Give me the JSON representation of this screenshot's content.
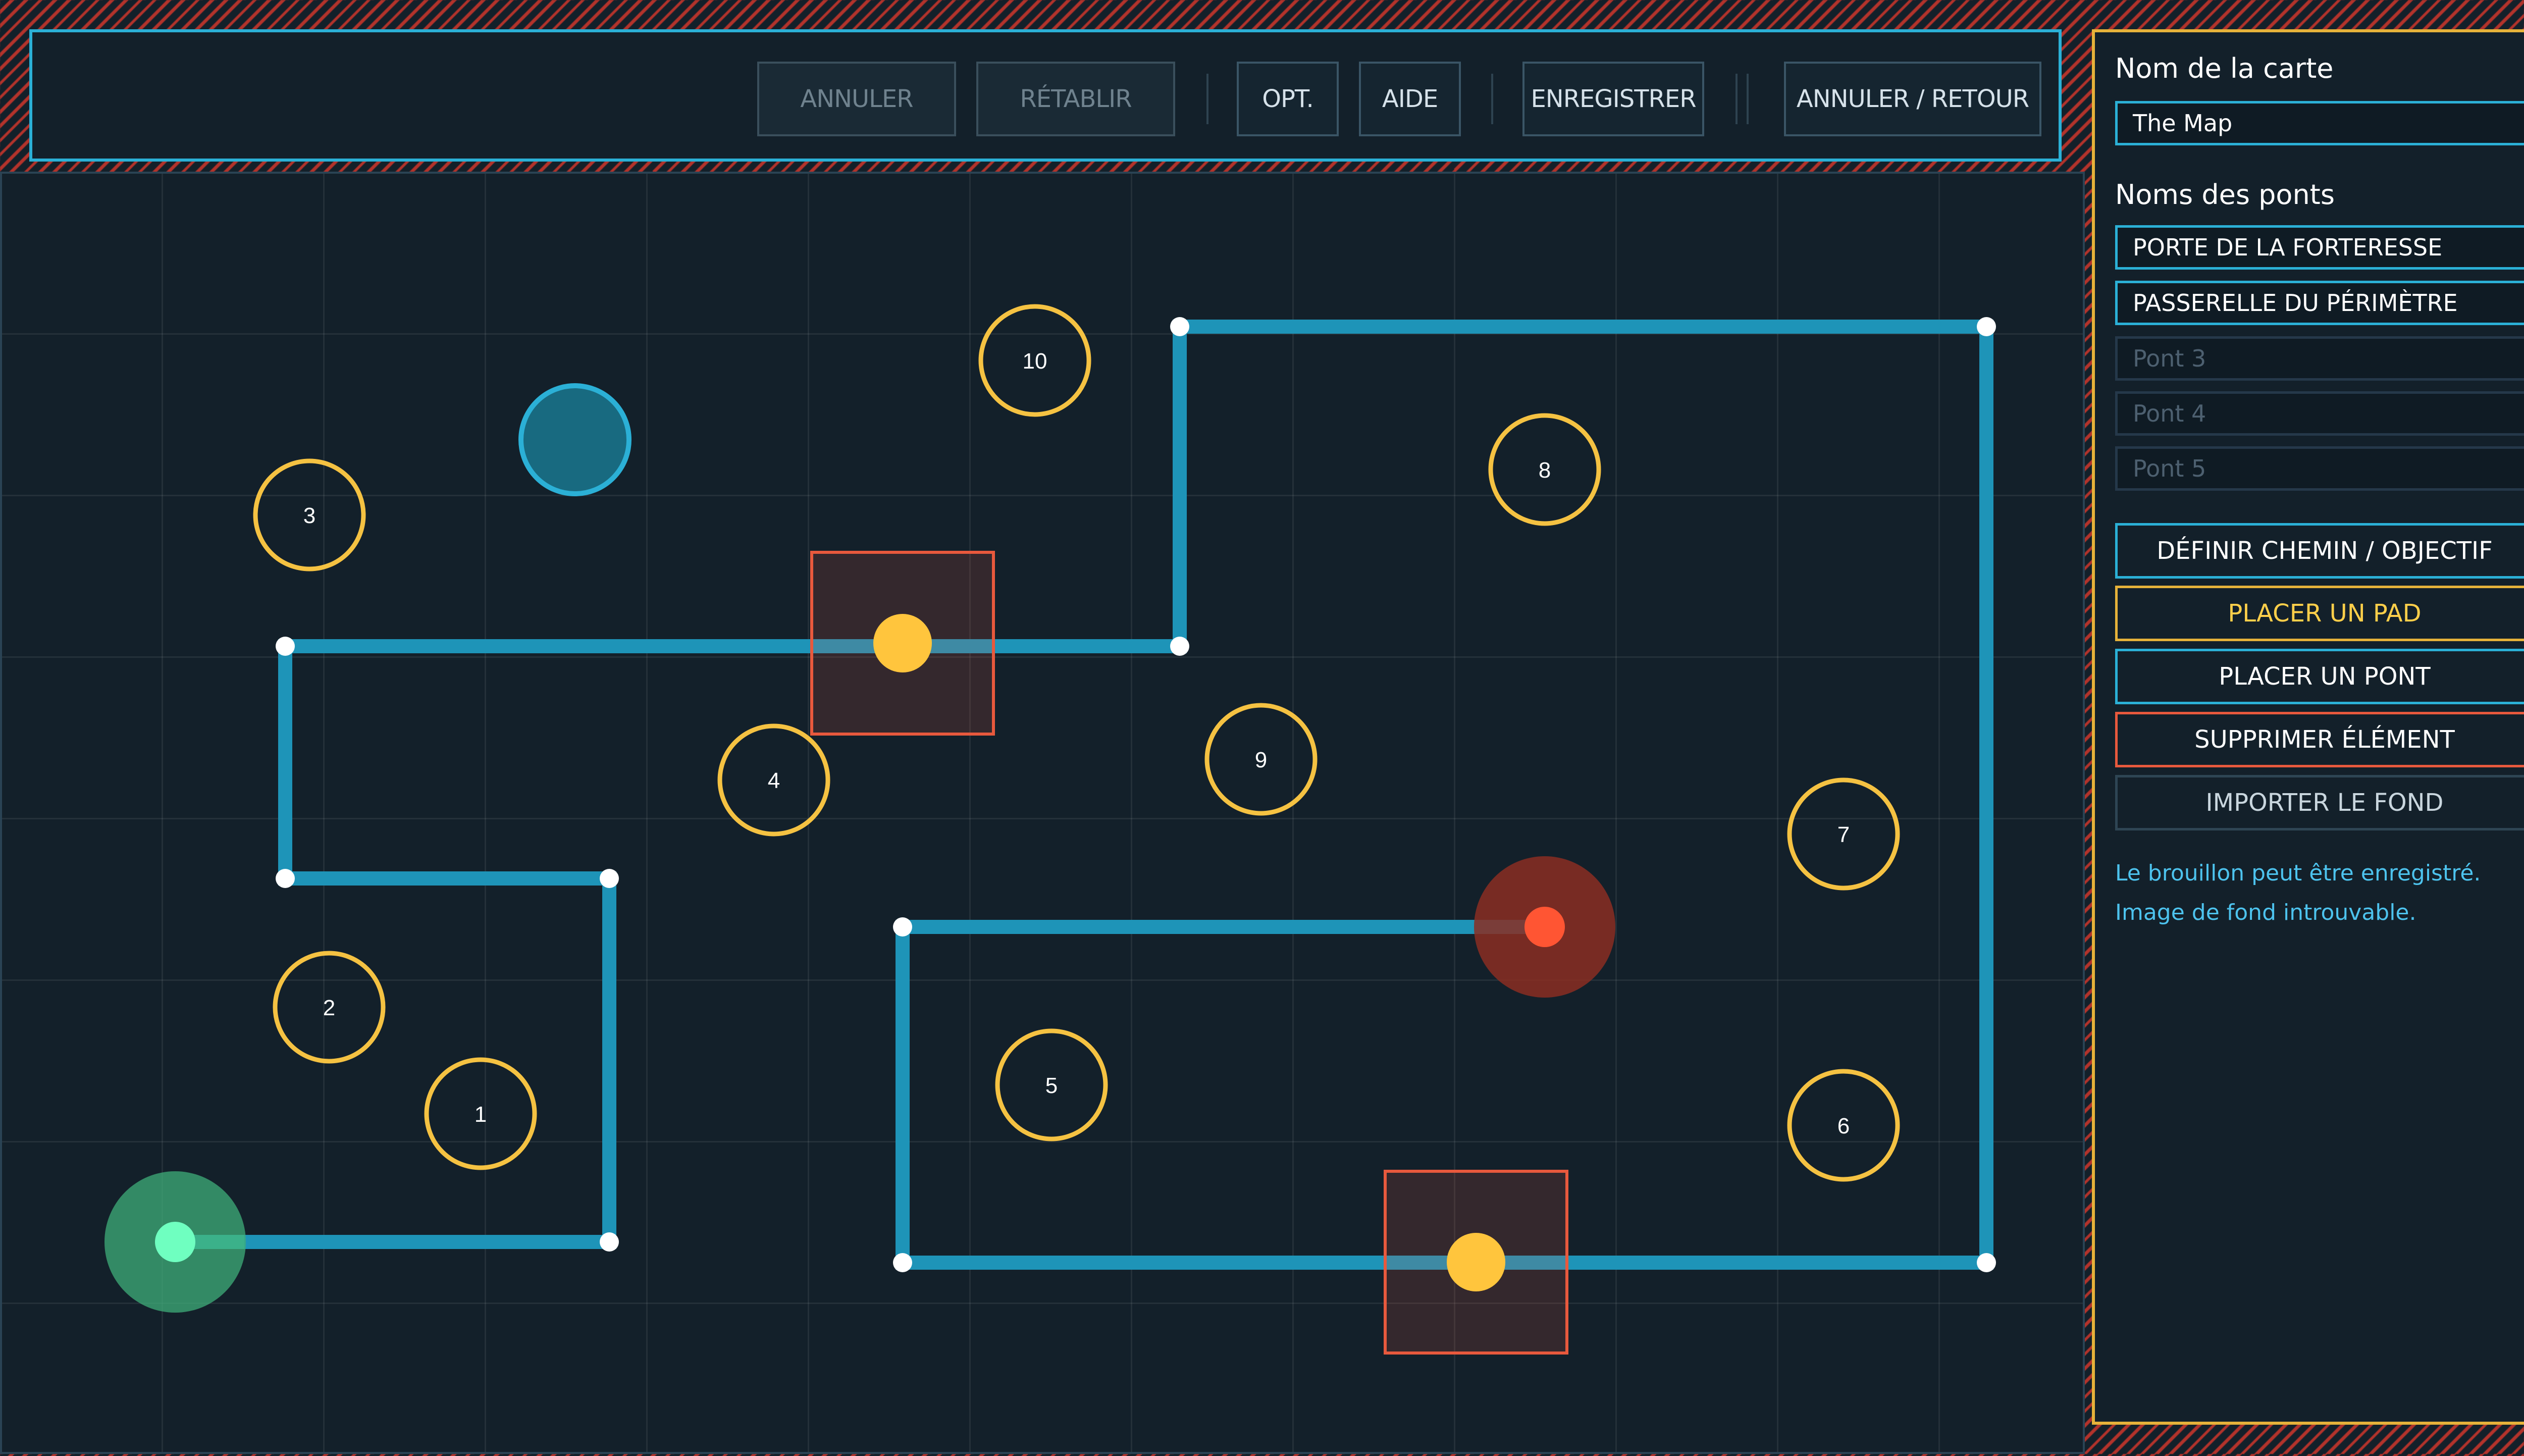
{
  "toolbar": {
    "buttons": [
      {
        "label": "ANNULER",
        "disabled": true
      },
      {
        "label": "RÉTABLIR",
        "disabled": true
      },
      {
        "label": "OPT.",
        "disabled": false
      },
      {
        "label": "AIDE",
        "disabled": false
      },
      {
        "label": "ENREGISTRER",
        "disabled": false
      },
      {
        "label": "ANNULER / RETOUR",
        "disabled": false
      }
    ]
  },
  "panel": {
    "map_name_label": "Nom de la carte",
    "map_name_value": "The Map",
    "bridge_names_label": "Noms des ponts",
    "bridges": [
      {
        "value": "PORTE DE LA FORTERESSE",
        "placeholder": ""
      },
      {
        "value": "PASSERELLE DU PÉRIMÈTRE",
        "placeholder": ""
      },
      {
        "value": "",
        "placeholder": "Pont 3"
      },
      {
        "value": "",
        "placeholder": "Pont 4"
      },
      {
        "value": "",
        "placeholder": "Pont 5"
      }
    ],
    "actions": {
      "define_path": "DÉFINIR CHEMIN / OBJECTIF",
      "place_pad": "PLACER UN PAD",
      "place_bridge": "PLACER UN PONT",
      "delete_element": "SUPPRIMER ÉLÉMENT",
      "import_background": "IMPORTER LE FOND"
    },
    "status_lines": [
      "Le brouillon peut être enregistré.",
      "Image de fond introuvable."
    ]
  },
  "map": {
    "pads": [
      "1",
      "2",
      "3",
      "4",
      "5",
      "6",
      "7",
      "8",
      "9",
      "10"
    ],
    "colors": {
      "path": "#1e94b8",
      "pad_ring": "#f5c242",
      "start": "#6fffc0",
      "goal": "#ff5533",
      "bridge_dot": "#ffc53d",
      "bridge_box": "#e8593d",
      "grid_border": "#2a4354"
    },
    "markers": [
      "start",
      "goal",
      "bridge",
      "bridge",
      "token"
    ]
  }
}
